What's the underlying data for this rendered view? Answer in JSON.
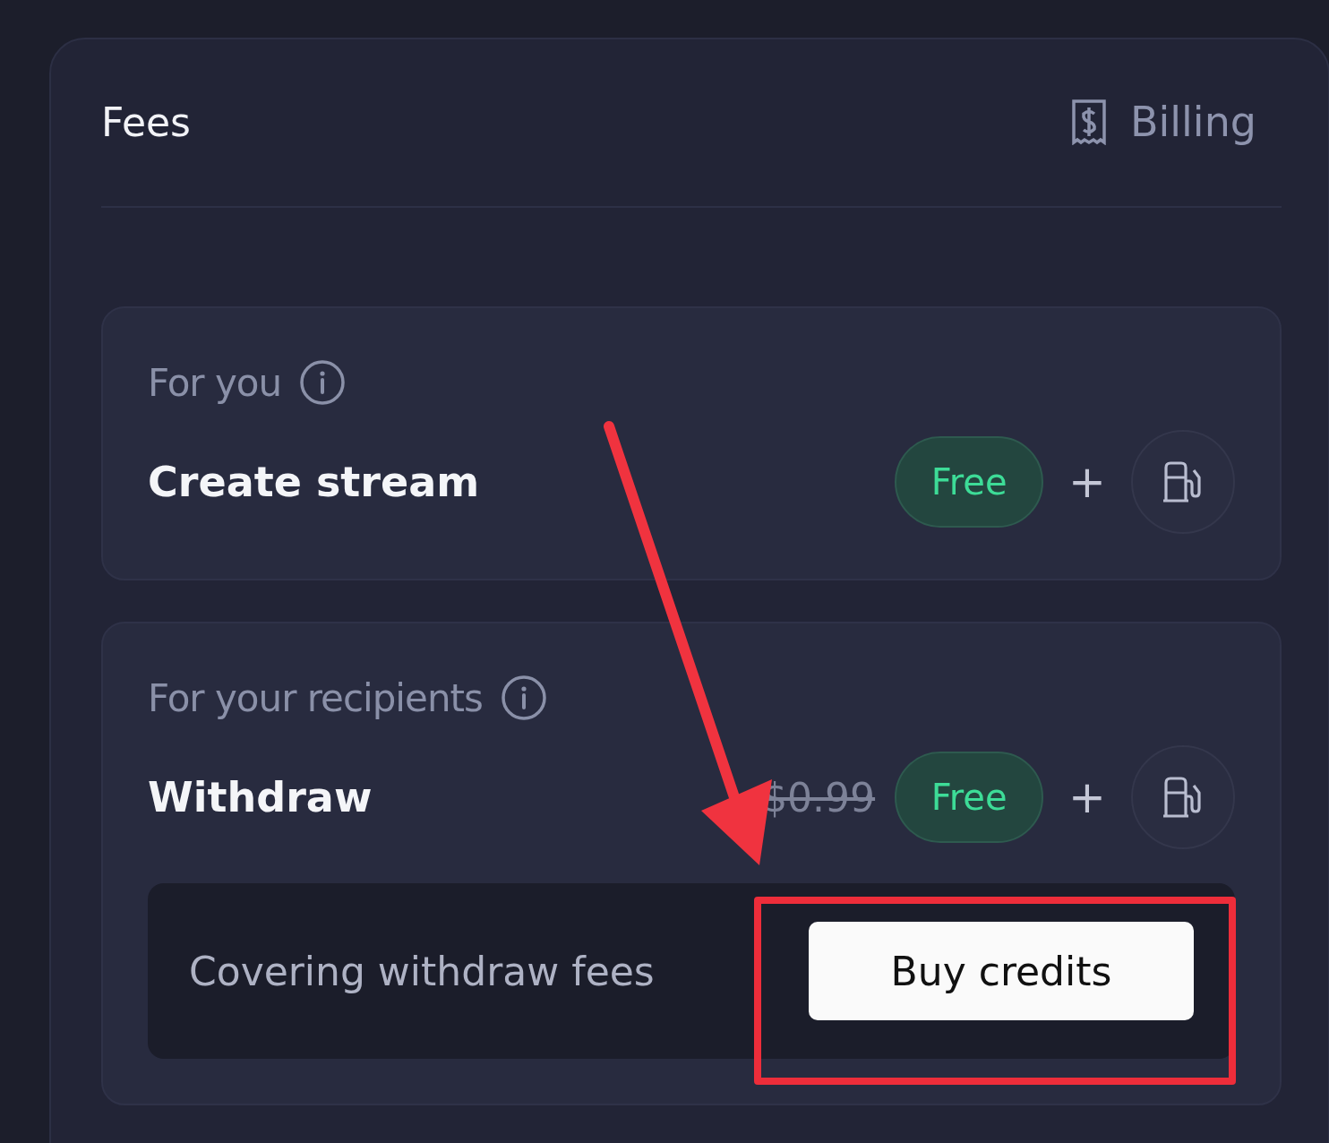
{
  "card": {
    "title": "Fees",
    "billing_link": "Billing"
  },
  "sections": [
    {
      "kind": "plain",
      "label": "For you",
      "row": {
        "name": "Create stream",
        "badge": "Free",
        "plus": "+"
      }
    },
    {
      "kind": "credits",
      "label": "For your recipients",
      "row": {
        "name": "Withdraw",
        "old_price": "$0.99",
        "badge": "Free",
        "plus": "+"
      },
      "note": {
        "text": "Covering withdraw fees",
        "button": "Buy credits"
      }
    }
  ],
  "annotation": {
    "arrow": true,
    "highlight": true
  }
}
